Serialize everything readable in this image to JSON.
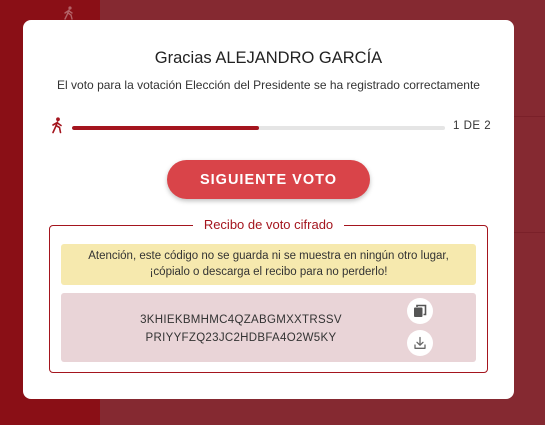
{
  "modal": {
    "title": "Gracias ALEJANDRO GARCÍA",
    "subtitle": "El voto para la votación Elección del Presidente se ha registrado correctamente",
    "progress": {
      "label": "1 DE 2",
      "fraction": 0.5
    },
    "next_button": "SIGUIENTE VOTO",
    "receipt": {
      "legend": "Recibo de voto cifrado",
      "warning_line1": "Atención, este código no se guarda ni se muestra en ningún otro lugar,",
      "warning_line2": "¡cópialo o descarga el recibo para no perderlo!",
      "code_line1": "3KHIEKBMHMC4QZABGMXXTRSSV",
      "code_line2": "PRIYYFZQ23JC2HDBFA4O2W5KY"
    }
  },
  "colors": {
    "accent": "#a4151e",
    "button": "#d94449",
    "warning_bg": "#f6e9ae",
    "code_bg": "#e9d4d7"
  },
  "icons": [
    "walking-person-icon",
    "copy-icon",
    "download-icon"
  ]
}
